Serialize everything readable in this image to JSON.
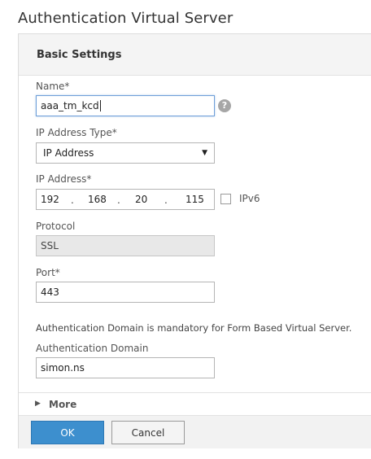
{
  "page": {
    "title": "Authentication Virtual Server"
  },
  "panel": {
    "title": "Basic Settings"
  },
  "form": {
    "name": {
      "label": "Name*",
      "value": "aaa_tm_kcd"
    },
    "help_glyph": "?",
    "ip_type": {
      "label": "IP Address Type*",
      "value": "IP Address",
      "arrow": "▼"
    },
    "ip_address": {
      "label": "IP Address*",
      "octets": [
        "192",
        "168",
        "20",
        "115"
      ],
      "separator": "."
    },
    "ipv6": {
      "label": "IPv6",
      "checked": false
    },
    "protocol": {
      "label": "Protocol",
      "value": "SSL"
    },
    "port": {
      "label": "Port*",
      "value": "443"
    },
    "note": "Authentication Domain is mandatory for Form Based Virtual Server.",
    "auth_domain": {
      "label": "Authentication Domain",
      "value": "simon.ns"
    }
  },
  "more": {
    "label": "More",
    "arrow": "▶"
  },
  "footer": {
    "ok_label": "OK",
    "cancel_label": "Cancel"
  },
  "colors": {
    "accent": "#3d8fce",
    "focus_border": "#6f9fd8",
    "readonly_bg": "#e8e8e8"
  }
}
